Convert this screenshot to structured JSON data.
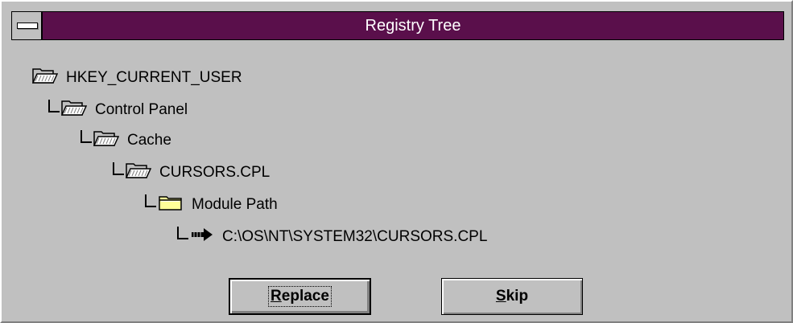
{
  "window": {
    "title": "Registry Tree"
  },
  "tree": {
    "nodes": [
      {
        "label": "HKEY_CURRENT_USER",
        "icon": "open-folder-icon"
      },
      {
        "label": "Control Panel",
        "icon": "open-folder-icon"
      },
      {
        "label": "Cache",
        "icon": "open-folder-icon"
      },
      {
        "label": "CURSORS.CPL",
        "icon": "open-folder-icon"
      },
      {
        "label": "Module Path",
        "icon": "closed-folder-icon"
      },
      {
        "label": "C:\\OS\\NT\\SYSTEM32\\CURSORS.CPL",
        "icon": "arrow-right-icon"
      }
    ]
  },
  "buttons": {
    "replace": {
      "mnemonic": "R",
      "rest": "eplace"
    },
    "skip": {
      "mnemonic": "S",
      "rest": "kip"
    }
  },
  "colors": {
    "titlebar": "#5a0f4b",
    "face": "#c0c0c0",
    "folder": "#ffff99"
  }
}
